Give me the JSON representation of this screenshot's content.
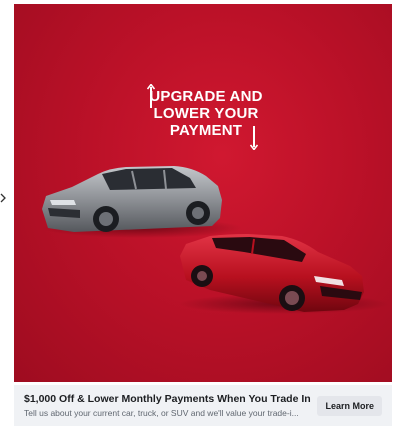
{
  "ad": {
    "headline_lines": [
      "UPGRADE AND",
      "LOWER YOUR",
      "PAYMENT"
    ],
    "title": "$1,000 Off & Lower Monthly Payments When You Trade In",
    "description": "Tell us about your current car, truck, or SUV and we'll value your trade-i...",
    "cta_label": "Learn More"
  },
  "colors": {
    "brand_red": "#bb1128",
    "silver_car": "#8a8d91",
    "red_car": "#c8142a",
    "footer_bg": "#f0f2f5"
  },
  "icons": {
    "side_nav": "chevron-right-icon",
    "headline_arrows": [
      "arrow-up-icon",
      "arrow-down-icon"
    ]
  }
}
